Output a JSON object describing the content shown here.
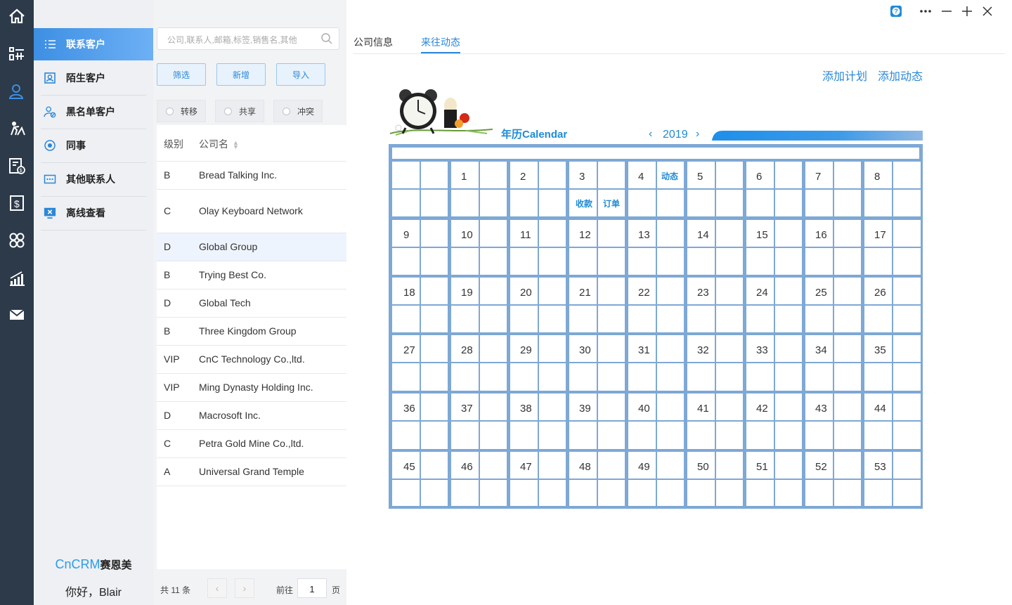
{
  "nav": {
    "items": [
      {
        "label": "联系客户",
        "icon": "contact-list-icon"
      },
      {
        "label": "陌生客户",
        "icon": "stranger-customer-icon"
      },
      {
        "label": "黑名单客户",
        "icon": "blacklist-icon"
      },
      {
        "label": "同事",
        "icon": "colleague-icon"
      },
      {
        "label": "其他联系人",
        "icon": "other-contacts-icon"
      },
      {
        "label": "离线查看",
        "icon": "offline-view-icon"
      }
    ],
    "brand_prefix": "CnCRM",
    "brand_suffix": "赛恩美",
    "greeting": "你好，Blair"
  },
  "list": {
    "search_placeholder": "公司,联系人,邮箱,标签,销售名,其他",
    "buttons": {
      "filter": "筛选",
      "add": "新增",
      "import": "导入"
    },
    "radios": {
      "transfer": "转移",
      "share": "共享",
      "conflict": "冲突"
    },
    "columns": {
      "level": "级别",
      "company": "公司名"
    },
    "rows": [
      {
        "level": "B",
        "company": "Bread Talking Inc."
      },
      {
        "level": "C",
        "company": "Olay Keyboard Network"
      },
      {
        "level": "D",
        "company": "Global Group"
      },
      {
        "level": "B",
        "company": "Trying Best Co."
      },
      {
        "level": "D",
        "company": "Global Tech"
      },
      {
        "level": "B",
        "company": "Three Kingdom Group"
      },
      {
        "level": "VIP",
        "company": "CnC Technology Co.,ltd."
      },
      {
        "level": "VIP",
        "company": "Ming Dynasty Holding Inc."
      },
      {
        "level": "D",
        "company": "Macrosoft Inc."
      },
      {
        "level": "C",
        "company": "Petra Gold Mine Co.,ltd."
      },
      {
        "level": "A",
        "company": "Universal Grand Temple"
      }
    ],
    "pager": {
      "total": "共 11 条",
      "goto": "前往",
      "page": "1",
      "page_unit": "页"
    }
  },
  "main": {
    "tabs": {
      "company_info": "公司信息",
      "activity": "来往动态"
    },
    "actions": {
      "add_plan": "添加计划",
      "add_activity": "添加动态"
    },
    "calendar": {
      "title": "年历Calendar",
      "year": "2019",
      "weeks": [
        [
          "",
          "1",
          "2",
          "3",
          "4",
          "5",
          "6",
          "7",
          "8"
        ],
        [
          "9",
          "10",
          "11",
          "12",
          "13",
          "14",
          "15",
          "16",
          "17"
        ],
        [
          "18",
          "19",
          "20",
          "21",
          "22",
          "23",
          "24",
          "25",
          "26"
        ],
        [
          "27",
          "28",
          "29",
          "30",
          "31",
          "32",
          "33",
          "34",
          "35"
        ],
        [
          "36",
          "37",
          "38",
          "39",
          "40",
          "41",
          "42",
          "43",
          "44"
        ],
        [
          "45",
          "46",
          "47",
          "48",
          "49",
          "50",
          "51",
          "52",
          "53"
        ]
      ],
      "tags": {
        "activity": "动态",
        "payment": "收款",
        "order": "订单"
      }
    }
  },
  "colors": {
    "accent": "#2b87d8",
    "rail": "#2c3a4a",
    "grid": "#7ea8d5"
  }
}
